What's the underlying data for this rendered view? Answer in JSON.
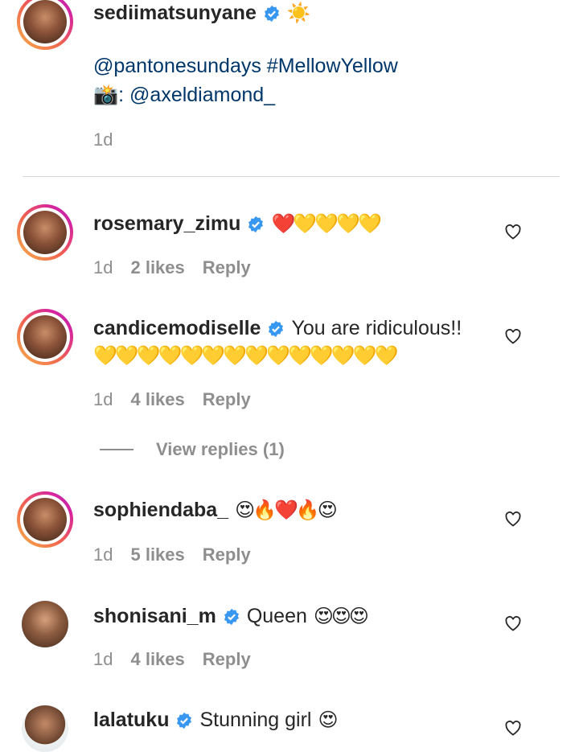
{
  "caption": {
    "username": "sediimatsunyane",
    "emoji": "☀️",
    "line1": "@pantonesundays #MellowYellow",
    "line2_icon": "📸",
    "line2_text": ": @axeldiamond_",
    "time": "1d"
  },
  "comments": [
    {
      "username": "rosemary_zimu",
      "text": "",
      "emoji": "❤️💛💛💛💛",
      "time": "1d",
      "likes": "2 likes",
      "reply": "Reply"
    },
    {
      "username": "candicemodiselle",
      "text": "You are ridiculous!!",
      "emoji": "💛💛💛💛💛💛💛💛💛💛💛💛💛💛",
      "time": "1d",
      "likes": "4 likes",
      "reply": "Reply",
      "view_replies": "View replies (1)"
    },
    {
      "username": "sophiendaba_",
      "text": "",
      "emoji": "😍🔥❤️🔥😍",
      "time": "1d",
      "likes": "5 likes",
      "reply": "Reply"
    },
    {
      "username": "shonisani_m",
      "text": "Queen",
      "emoji": "😍😍😍",
      "time": "1d",
      "likes": "4 likes",
      "reply": "Reply"
    },
    {
      "username": "lalatuku",
      "text": "Stunning girl",
      "emoji": "😍"
    }
  ],
  "colors": {
    "verified": "#3897f0",
    "link": "#00376b",
    "meta": "#8e8e8e"
  }
}
